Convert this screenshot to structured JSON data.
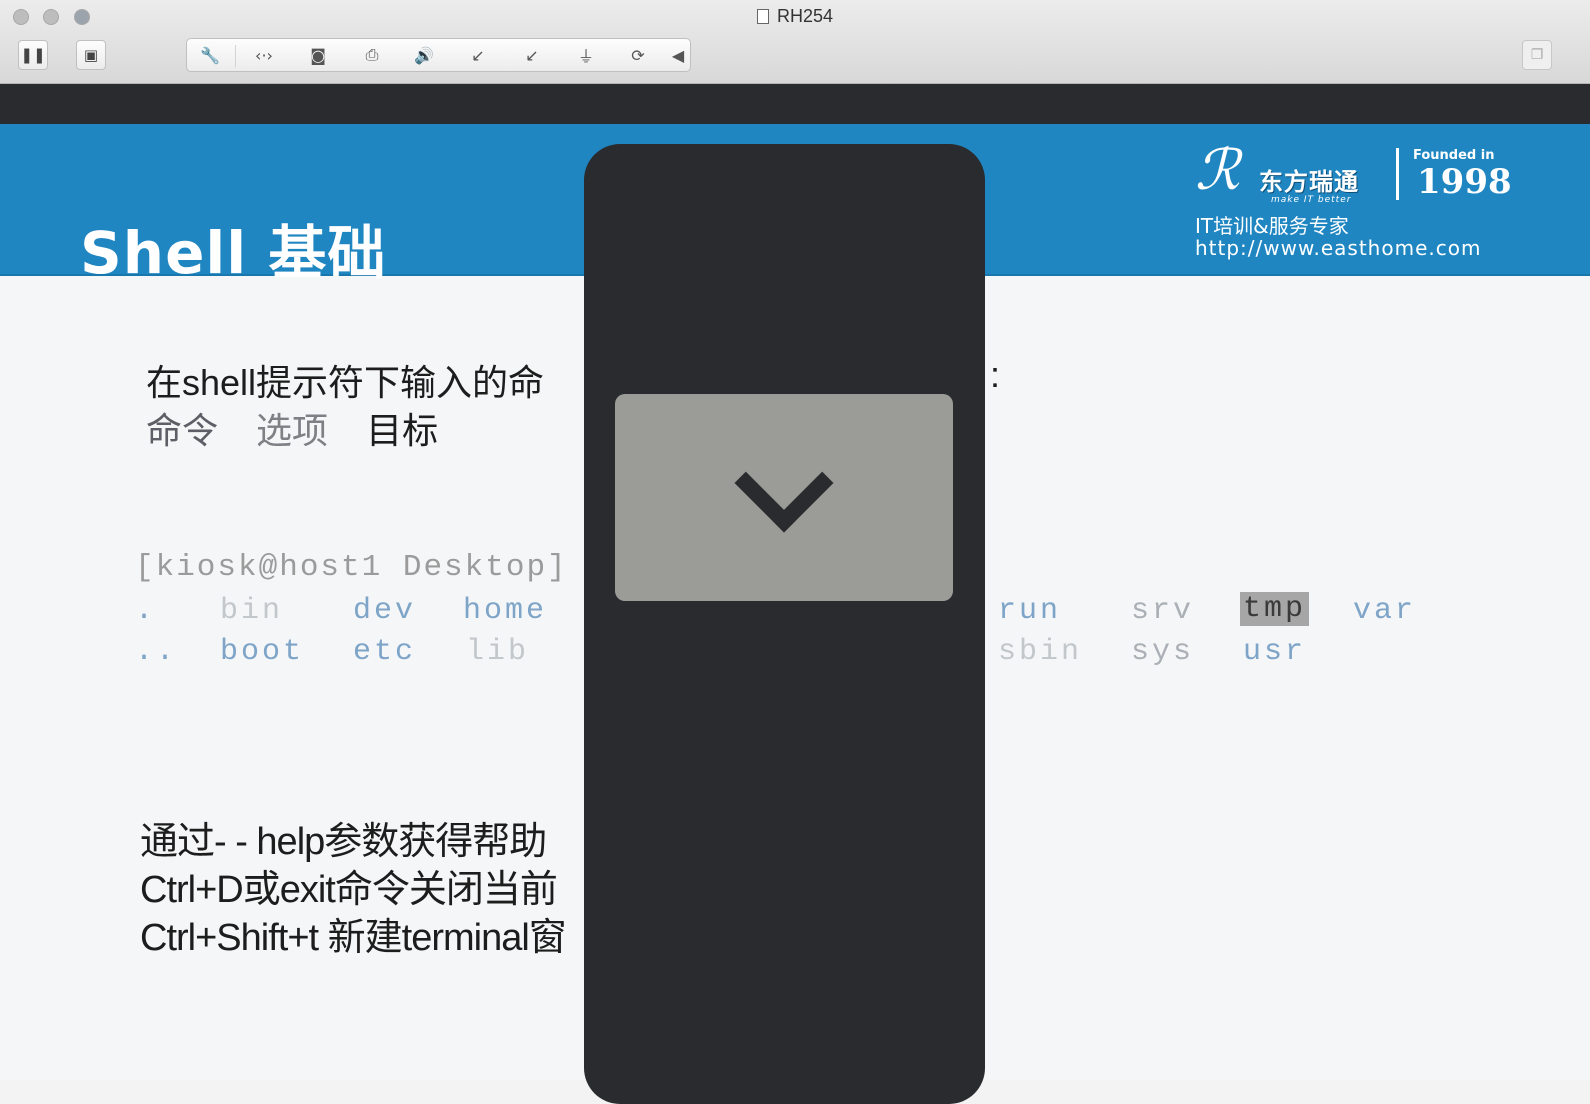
{
  "window": {
    "title": "RH254",
    "toolbar": {
      "pause": "pause-icon",
      "snapshot": "snapshot-icon",
      "group_icons": [
        "wrench-icon",
        "network-icon",
        "disk-icon",
        "printer-icon",
        "speaker-icon",
        "usb-icon",
        "usb-icon",
        "usb-icon",
        "sync-icon"
      ],
      "collapse": "collapse-left-icon",
      "right": "window-icon"
    }
  },
  "slide": {
    "title": "Shell 基础",
    "logo": {
      "company": "东方瑞通",
      "slogan": "make IT better",
      "founded": "Founded in",
      "year": "1998",
      "tagline": "IT培训&服务专家",
      "url": "http://www.easthome.com"
    },
    "line1": "在shell提示符下输入的命",
    "line1_tail": ":",
    "parts": [
      "命令",
      "选项",
      "目标"
    ],
    "prompt": "[kiosk@host1 Desktop]",
    "ls_row1": [
      ".",
      "bin",
      "dev",
      "home",
      "run",
      "srv",
      "tmp",
      "var"
    ],
    "ls_row2": [
      "..",
      "boot",
      "etc",
      "lib",
      "sbin",
      "sys",
      "usr"
    ],
    "bottom": [
      "通过- - help参数获得帮助",
      "Ctrl+D或exit命令关闭当前",
      "Ctrl+Shift+t 新建terminal窗"
    ]
  },
  "overlay": {
    "button_icon": "chevron-down-icon"
  },
  "colors": {
    "banner": "#1f86c2",
    "overlay": "#2a2b2e",
    "button": "#9b9c98"
  }
}
